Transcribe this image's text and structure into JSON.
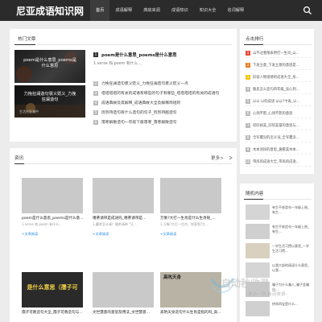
{
  "site": {
    "logo": "尼亚成语知识网"
  },
  "nav": [
    {
      "label": "首页",
      "active": true
    },
    {
      "label": "成语解释"
    },
    {
      "label": "典故来源"
    },
    {
      "label": "成语知识"
    },
    {
      "label": "知识大全"
    },
    {
      "label": "名词解释"
    }
  ],
  "hot": {
    "title": "热门文章",
    "featured": [
      {
        "caption_line1": "poem是什么意思_poems是",
        "caption_line2": "什么意思"
      },
      {
        "caption_line1": "力挽狂澜造句褒义贬义_力挽",
        "caption_line2": "狂澜造句",
        "caption_extra": "生活在狂澜中"
      }
    ],
    "main_title": "poem是什么意思_poems是什么意思",
    "main_desc": "1.verse 和 poem 有什么....",
    "list": [
      {
        "num": "2",
        "text": "力挽狂澜造句褒义贬义_力挽狂澜造句褒义贬义一点"
      },
      {
        "num": "3",
        "text": "塔塔塔塔的有关的成语有哪些的句子有哪些_塔塔塔塔的有关的成语句"
      },
      {
        "num": "4",
        "text": "成语典故及其解释_成语典故大全及解释简短的"
      },
      {
        "num": "5",
        "text": "厉厉持造句有什么造句的句子_厉厉持越造句"
      },
      {
        "num": "6",
        "text": "落寒解散造句一年级下册落寒_落寒解散造句"
      }
    ]
  },
  "latest": {
    "title": "资讯",
    "more": "更多>",
    "read_label": "+文章阅读",
    "cards": [
      {
        "title": "poem是什么意思_poems是什么意...",
        "desc": "1.verse 和 poem 有什么..."
      },
      {
        "title": "嗜茶请带是成语吗_嗜茶请带是...",
        "desc": "1.赢茶怎么请？嗜茶请带 \"又..."
      },
      {
        "title": "万象?大打一生肖是什么生肖呢_...",
        "desc": "1.万象?大打一生肖，划直到?大..."
      },
      {
        "title": "孺子可教造句大全_孺子可教造句与...",
        "thumb_caption": "是什么意思（孺子可"
      },
      {
        "title": "文世慧意的意思及用法_文世慧意...",
        "desc": ""
      },
      {
        "title": "高吭天身造句什么生肖是指的吗_高...",
        "thumb_caption": "高吭天身"
      }
    ]
  },
  "sidebar": {
    "rank_title": "点击排行",
    "rank": [
      {
        "num": "1",
        "text": "山不过重限表明打一生肖_山...",
        "color": "#e74c3c"
      },
      {
        "num": "2",
        "text": "下发立意_下发立意的意思是...",
        "color": "#e67e22"
      },
      {
        "num": "3",
        "text": "形容人物道德的成语大全_形...",
        "color": "#f1c40f"
      },
      {
        "num": "4",
        "text": "贩卖怎么造句四年级_丧心到...",
        "color": "#bbb"
      },
      {
        "num": "5",
        "text": "以以 以的成语 以以?卞表_以...",
        "color": "#bbb"
      },
      {
        "num": "6",
        "text": "心领不影_心领不影的意思",
        "color": "#bbb"
      },
      {
        "num": "7",
        "text": "欣欣却美_欣欣美誉的意思与...",
        "color": "#bbb"
      },
      {
        "num": "8",
        "text": "全军覆没的近义词_全军覆没...",
        "color": "#bbb"
      },
      {
        "num": "9",
        "text": "木本消风的意思_遍愿美木本...",
        "color": "#bbb"
      },
      {
        "num": "10",
        "text": "带风的成语大全_带风的成语...",
        "color": "#bbb"
      }
    ],
    "random_title": "随机内容",
    "random": [
      {
        "text": "有生不老造句一年级上册_有生..."
      },
      {
        "text": "有生不老造句一年级上册_有生..."
      },
      {
        "text": "一学生活习惯以意思_一学生活习惯..."
      },
      {
        "text": "以我大部的阅读什么意思_以我..."
      },
      {
        "text": "骗子为什么骗人_骗子会骗出..."
      },
      {
        "text": "拼命四宝是什么..."
      }
    ]
  },
  "watermark": {
    "main": "自动秒收录",
    "sub": "-来访一次·自动收录-"
  }
}
